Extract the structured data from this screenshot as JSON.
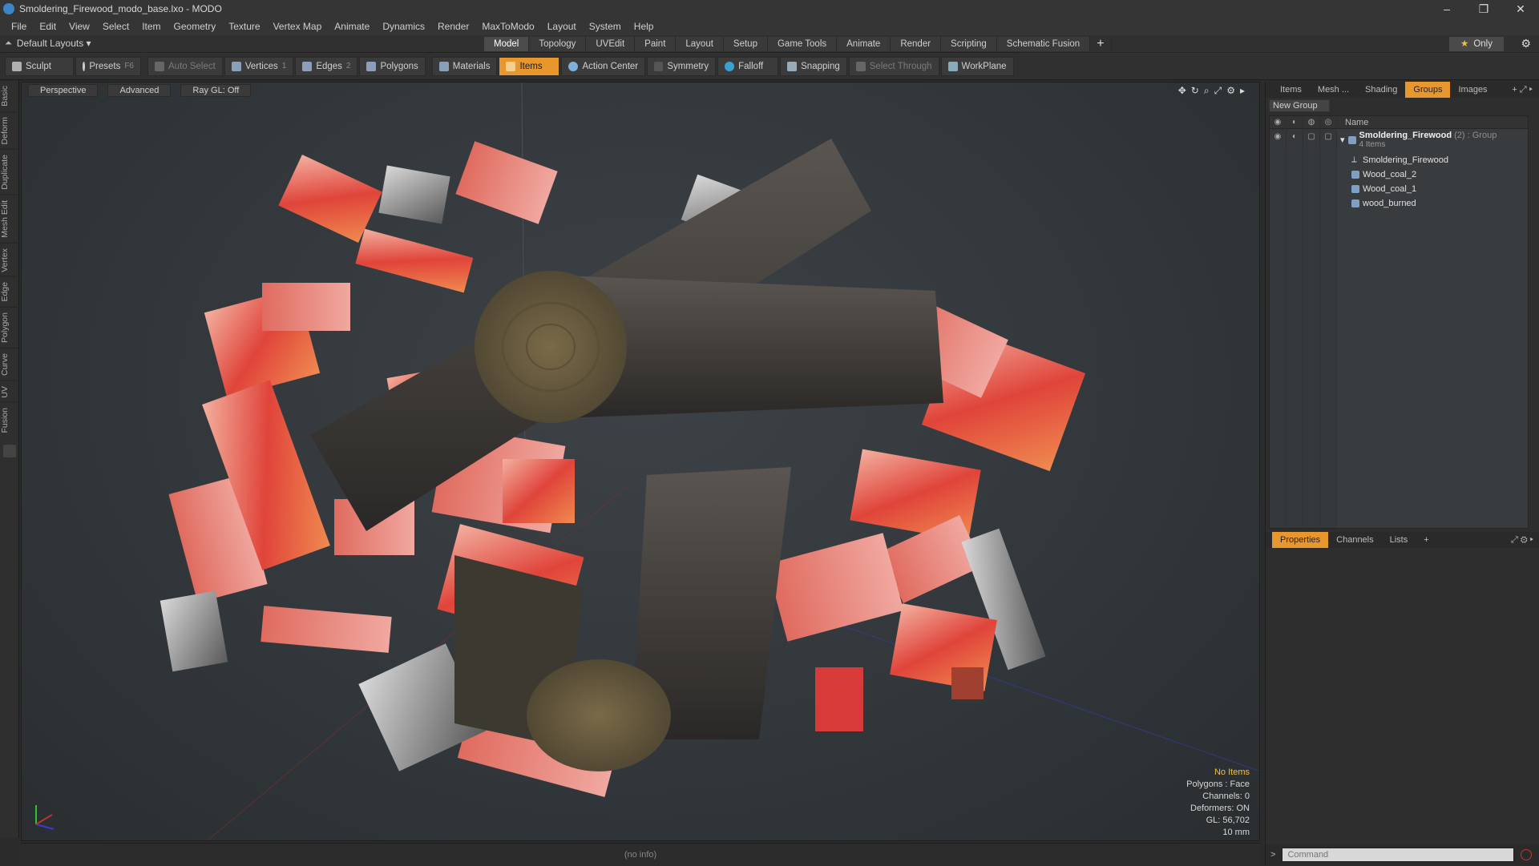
{
  "window": {
    "title": "Smoldering_Firewood_modo_base.lxo - MODO",
    "controls": [
      "–",
      "❐",
      "✕"
    ]
  },
  "menu": [
    "File",
    "Edit",
    "View",
    "Select",
    "Item",
    "Geometry",
    "Texture",
    "Vertex Map",
    "Animate",
    "Dynamics",
    "Render",
    "MaxToModo",
    "Layout",
    "System",
    "Help"
  ],
  "layouts": {
    "label": "Default Layouts ▾"
  },
  "modes": [
    "Model",
    "Topology",
    "UVEdit",
    "Paint",
    "Layout",
    "Setup",
    "Game Tools",
    "Animate",
    "Render",
    "Scripting",
    "Schematic Fusion"
  ],
  "modes_active": "Model",
  "only_button": {
    "star": "★",
    "label": "Only"
  },
  "toolbar": {
    "sculpt": "Sculpt",
    "presets": "Presets",
    "presets_key": "F6",
    "auto_select": "Auto Select",
    "vertices": "Vertices",
    "vertices_key": "1",
    "edges": "Edges",
    "edges_key": "2",
    "polygons": "Polygons",
    "materials": "Materials",
    "items": "Items",
    "action_center": "Action Center",
    "symmetry": "Symmetry",
    "falloff": "Falloff",
    "snapping": "Snapping",
    "select_through": "Select Through",
    "workplane": "WorkPlane"
  },
  "left_tabs": [
    "Basic",
    "Deform",
    "Duplicate",
    "Mesh Edit",
    "Vertex",
    "Edge",
    "Polygon",
    "Curve",
    "UV",
    "Fusion"
  ],
  "viewport": {
    "view": "Perspective",
    "shading": "Advanced",
    "raygl": "Ray GL: Off",
    "info": {
      "no_items": "No Items",
      "polygons": "Polygons : Face",
      "channels": "Channels: 0",
      "deformers": "Deformers: ON",
      "gl": "GL: 56,702",
      "scale": "10 mm"
    }
  },
  "status": "(no info)",
  "right_panel": {
    "tabs": [
      "Items",
      "Mesh ...",
      "Shading",
      "Groups",
      "Images"
    ],
    "active_tab": "Groups",
    "new_group": "New Group",
    "name_header": "Name",
    "group": {
      "name": "Smoldering_Firewood",
      "count": "(2)",
      "type": ": Group",
      "items": "4 Items"
    },
    "children": [
      "Smoldering_Firewood",
      "Wood_coal_2",
      "Wood_coal_1",
      "wood_burned"
    ],
    "prop_tabs": [
      "Properties",
      "Channels",
      "Lists"
    ],
    "command_placeholder": "Command"
  },
  "colors": {
    "accent": "#e8962e",
    "highlight": "#f0c040"
  }
}
